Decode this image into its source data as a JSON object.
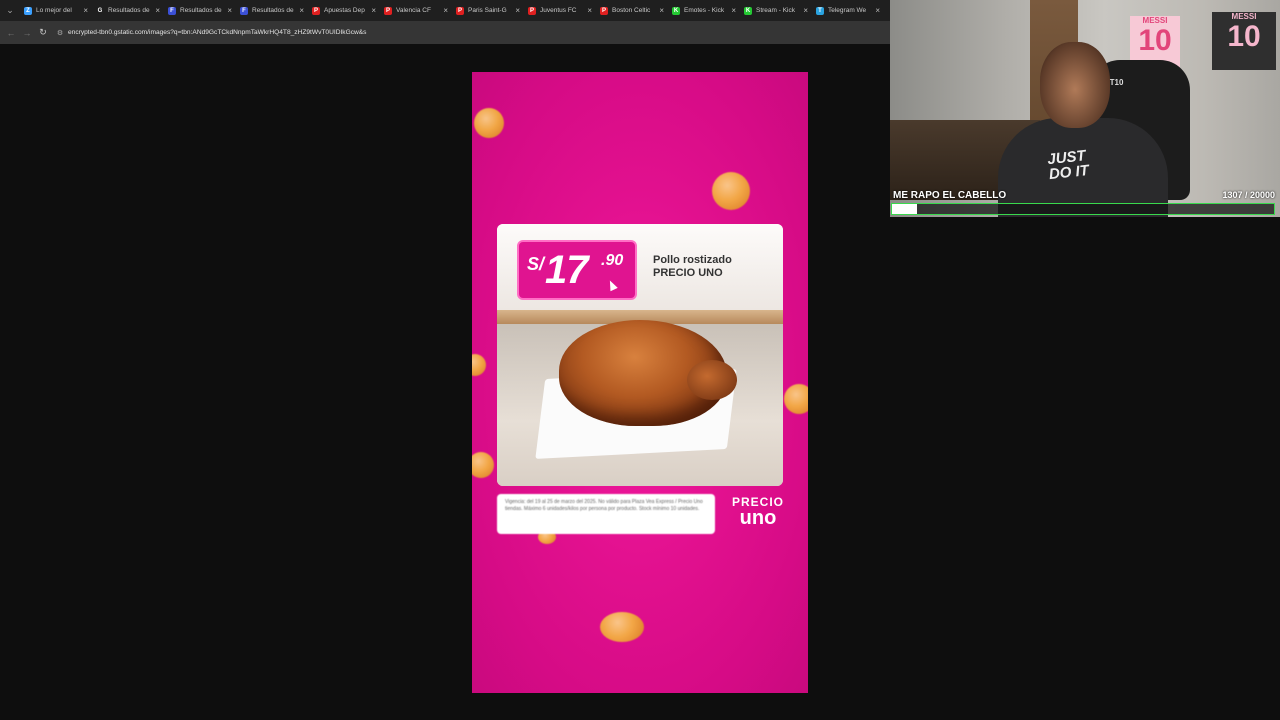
{
  "browser": {
    "tabs": [
      {
        "label": "Lo mejor del",
        "favicon": "Z",
        "color": "#3aa0ff",
        "active": false
      },
      {
        "label": "Resultados de",
        "favicon": "G",
        "color": "#1f1f1f",
        "active": false
      },
      {
        "label": "Resultados de",
        "favicon": "F",
        "color": "#3b50d6",
        "active": false
      },
      {
        "label": "Resultados de",
        "favicon": "F",
        "color": "#3b50d6",
        "active": false
      },
      {
        "label": "Apuestas Dep",
        "favicon": "P",
        "color": "#e02020",
        "active": false
      },
      {
        "label": "Valencia CF",
        "favicon": "P",
        "color": "#e02020",
        "active": false
      },
      {
        "label": "Paris Saint-G",
        "favicon": "P",
        "color": "#e02020",
        "active": false
      },
      {
        "label": "Juventus FC",
        "favicon": "P",
        "color": "#e02020",
        "active": false
      },
      {
        "label": "Boston Celtic",
        "favicon": "P",
        "color": "#e02020",
        "active": false
      },
      {
        "label": "Emotes - Kick",
        "favicon": "K",
        "color": "#24c933",
        "active": false
      },
      {
        "label": "Stream - Kick",
        "favicon": "K",
        "color": "#24c933",
        "active": false
      },
      {
        "label": "Telegram We",
        "favicon": "T",
        "color": "#2aa3e0",
        "active": false
      }
    ],
    "url": "encrypted-tbn0.gstatic.com/images?q=tbn:ANd9GcTCkdNnpmTaWkrHQ4T8_zHZ9tWvT0UIDIkGcw&s"
  },
  "ad": {
    "price_currency": "S/",
    "price_main": "17",
    "price_cents": ".90",
    "product_line1": "Pollo rostizado",
    "product_line2": "PRECIO UNO",
    "terms_text": "Vigencia: del 19 al 25 de marzo del 2025. No válido para Plaza Vea Express / Precio Uno tiendas. Máximo 6 unidades/kilos por persona por producto. Stock mínimo 10 unidades.",
    "brand_line1": "PRECIO",
    "brand_line2": "uno"
  },
  "webcam": {
    "goal_title": "ME RAPO EL CABELLO",
    "goal_count": "1307  / 20000",
    "goal_current": 1307,
    "goal_target": 20000,
    "goal_color": "#39d94d",
    "poster_name": "MESSI",
    "poster_number": "10",
    "shirt_text_1": "JUST",
    "shirt_text_2": "DO IT",
    "chair_label": "FAT10"
  }
}
